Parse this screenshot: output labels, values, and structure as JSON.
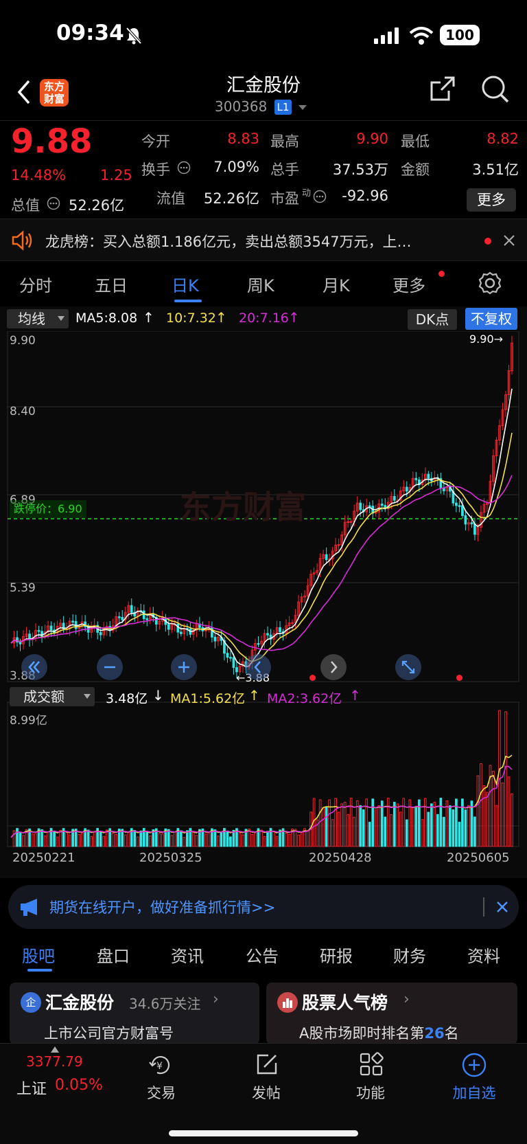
{
  "status": {
    "time": "09:34",
    "battery": "100"
  },
  "header": {
    "logo_line1": "东方",
    "logo_line2": "财富",
    "title": "汇金股份",
    "code": "300368",
    "level": "L1"
  },
  "quote": {
    "price": "9.88",
    "change_pct": "14.48%",
    "change": "1.25",
    "open_label": "今开",
    "open": "8.83",
    "high_label": "最高",
    "high": "9.90",
    "low_label": "最低",
    "low": "8.82",
    "turnover_label": "换手",
    "turnover": "7.09%",
    "volume_label": "总手",
    "volume": "37.53万",
    "amount_label": "金额",
    "amount": "3.51亿",
    "mktcap_label": "总值",
    "mktcap": "52.26亿",
    "float_label": "流值",
    "float_cap": "52.26亿",
    "pe_label": "市盈",
    "pe_sup": "动",
    "pe": "-92.96",
    "more": "更多"
  },
  "notice": {
    "text": "龙虎榜：买入总额1.186亿元，卖出总额3547万元，上…"
  },
  "period_tabs": [
    "分时",
    "五日",
    "日K",
    "周K",
    "月K",
    "更多"
  ],
  "chart": {
    "ma_selector": "均线",
    "ma5": "MA5:8.08",
    "ma10": "10:7.32",
    "ma20": "20:7.16",
    "dk": "DK点",
    "adjust": "不复权",
    "limit_down": "跌停价：6.90",
    "watermark": "东方财富",
    "y_labels": [
      "9.90",
      "8.40",
      "6.89",
      "5.39",
      "3.88"
    ],
    "high_marker": "9.90",
    "low_marker": "3.88",
    "vol_selector": "成交额",
    "vol_value": "3.48亿",
    "vol_ma1": "MA1:5.62亿",
    "vol_ma2": "MA2:3.62亿",
    "vol_top": "8.99亿",
    "dates": [
      "20250221",
      "20250325",
      "20250428",
      "20250605"
    ],
    "colors": {
      "up": "#f5222d",
      "down": "#2ee6e6",
      "ma5": "#ffffff",
      "ma10": "#f5e04a",
      "ma20": "#d62fd6"
    }
  },
  "banner": {
    "text": "期货在线开户，做好准备抓行情>>"
  },
  "bottom_tabs": [
    "股吧",
    "盘口",
    "资讯",
    "公告",
    "研报",
    "财务",
    "资料"
  ],
  "cards": [
    {
      "title": "汇金股份",
      "meta": "34.6万关注",
      "sub": "上市公司官方财富号"
    },
    {
      "title": "股票人气榜",
      "sub_prefix": "A股市场即时排名第",
      "rank": "26",
      "sub_suffix": "名"
    }
  ],
  "nav": {
    "index_value": "3377.79",
    "index_name": "上证",
    "index_change": "0.05%",
    "items": [
      "交易",
      "发帖",
      "功能",
      "加自选"
    ]
  }
}
